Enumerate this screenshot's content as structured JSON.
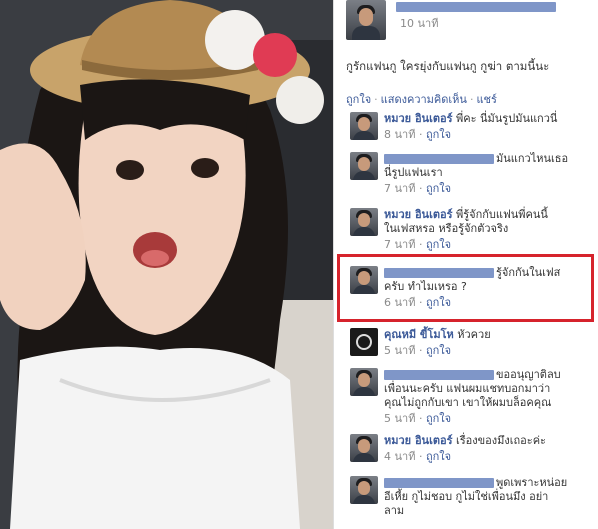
{
  "post": {
    "time": "10 นาที",
    "status": "กูรักแฟนกู ใครยุ่งกับแฟนกู กูฆ่า ตามนี้นะ",
    "actions": [
      "ถูกใจ",
      "แสดงความคิดเห็น",
      "แชร์"
    ]
  },
  "comments": [
    {
      "name": "หมวย อินเตอร์",
      "text": "พี่คะ นี่มันรูปมันแกวนี่",
      "time": "8 นาที",
      "like": "ถูกใจ"
    },
    {
      "name": "",
      "text": "มันแกวไหนเธอ",
      "text2": "นี่รูปแฟนเรา",
      "time": "7 นาที",
      "like": "ถูกใจ"
    },
    {
      "name": "หมวย อินเตอร์",
      "text": "พี่รู้จักกับแฟนพี่คนนี้",
      "text2": "ในเฟสหรอ หรือรู้จักตัวจริง",
      "time": "7 นาที",
      "like": "ถูกใจ"
    },
    {
      "name": "",
      "text": "รู้จักกันในเฟส",
      "text2": "ครับ ทำไมเหรอ ?",
      "time": "6 นาที",
      "like": "ถูกใจ"
    },
    {
      "name": "คุณหมี ขี้โมโห",
      "text": "หัวควย",
      "time": "5 นาที",
      "like": "ถูกใจ"
    },
    {
      "name": "",
      "text": "ขออนุญาติลบ",
      "text2": "เพื่อนนะครับ แฟนผมแชทบอกมาว่า",
      "text3": "คุณไม่ถูกกับเขา เขาให้ผมบล็อคคุณ",
      "time": "5 นาที",
      "like": "ถูกใจ"
    },
    {
      "name": "หมวย อินเตอร์",
      "text": "เรื่องของมึงเถอะค่ะ",
      "time": "4 นาที",
      "like": "ถูกใจ"
    },
    {
      "name": "",
      "text": "พูดเพราะหน่อย",
      "text2": "อีเหี้ย กูไม่ชอบ กูไม่ใช่เพื่อนมึง อย่า",
      "text3": "ลาม"
    }
  ],
  "colors": {
    "link": "#3b5998",
    "highlight": "#d6232c",
    "redaction": "#7f96c8"
  }
}
